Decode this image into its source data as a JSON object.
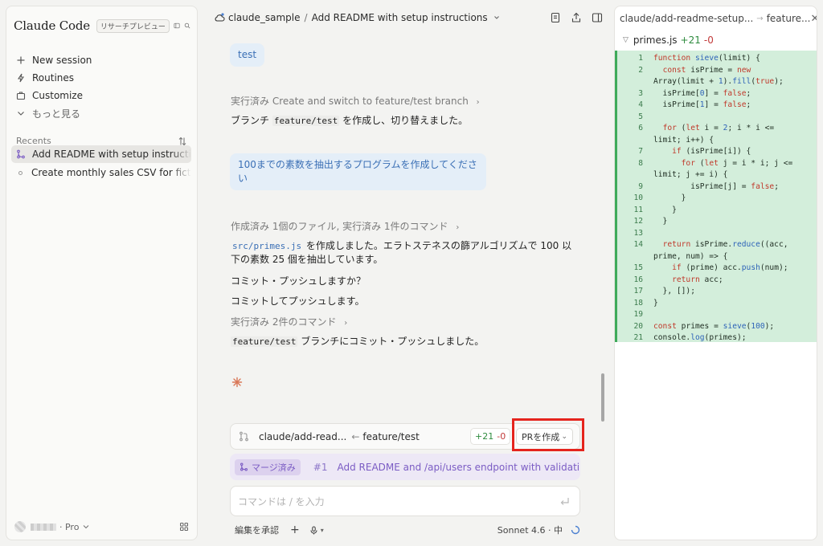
{
  "sidebar": {
    "brand": "Claude Code",
    "badge": "リサーチプレビュー",
    "nav": [
      {
        "label": "New session",
        "icon": "plus-icon"
      },
      {
        "label": "Routines",
        "icon": "routines-icon"
      },
      {
        "label": "Customize",
        "icon": "briefcase-icon"
      },
      {
        "label": "もっと見る",
        "icon": "chevron-down-icon"
      }
    ],
    "recents_label": "Recents",
    "recents": [
      {
        "label": "Add README with setup instructions",
        "active": true
      },
      {
        "label": "Create monthly sales CSV for fictional",
        "active": false
      }
    ],
    "plan": "· Pro"
  },
  "header": {
    "repo": "claude_sample",
    "separator": "/",
    "title": "Add README with setup instructions"
  },
  "chat": {
    "msg1": "test",
    "meta1": "実行済み Create and switch to feature/test branch",
    "reply1_pre": "ブランチ ",
    "reply1_code": "feature/test",
    "reply1_post": " を作成し、切り替えました。",
    "msg2": "100までの素数を抽出するプログラムを作成してください",
    "meta2": "作成済み 1個のファイル, 実行済み 1件のコマンド",
    "reply2_code": "src/primes.js",
    "reply2_text": " を作成しました。エラトステネスの篩アルゴリズムで 100 以下の素数 25 個を抽出しています。",
    "reply3": "コミット・プッシュしますか？",
    "reply4": "コミットしてプッシュします。",
    "meta3": "実行済み 2件のコマンド",
    "reply5_code": "feature/test",
    "reply5_text": " ブランチにコミット・プッシュしました。"
  },
  "branchbar": {
    "source": "claude/add-read...",
    "arrow": "←",
    "target": "feature/test",
    "additions": "+21",
    "deletions": "-0",
    "pr_button": "PRを作成"
  },
  "merged": {
    "badge": "マージ済み",
    "number": "#1",
    "title": "Add README and /api/users endpoint with validati..."
  },
  "input": {
    "placeholder": "コマンドは / を入力"
  },
  "footer": {
    "accept_edits": "編集を承認",
    "model": "Sonnet 4.6 · 中"
  },
  "panel": {
    "source_branch": "claude/add-readme-setup...",
    "target_branch": "feature...",
    "file": "primes.js",
    "additions": "+21",
    "deletions": "-0",
    "code": [
      {
        "n": "1",
        "t": "function sieve(limit) {"
      },
      {
        "n": "2",
        "t": "  const isPrime = new"
      },
      {
        "n": "",
        "t": "Array(limit + 1).fill(true);"
      },
      {
        "n": "3",
        "t": "  isPrime[0] = false;"
      },
      {
        "n": "4",
        "t": "  isPrime[1] = false;"
      },
      {
        "n": "5",
        "t": ""
      },
      {
        "n": "6",
        "t": "  for (let i = 2; i * i <="
      },
      {
        "n": "",
        "t": "limit; i++) {"
      },
      {
        "n": "7",
        "t": "    if (isPrime[i]) {"
      },
      {
        "n": "8",
        "t": "      for (let j = i * i; j <="
      },
      {
        "n": "",
        "t": "limit; j += i) {"
      },
      {
        "n": "9",
        "t": "        isPrime[j] = false;"
      },
      {
        "n": "10",
        "t": "      }"
      },
      {
        "n": "11",
        "t": "    }"
      },
      {
        "n": "12",
        "t": "  }"
      },
      {
        "n": "13",
        "t": ""
      },
      {
        "n": "14",
        "t": "  return isPrime.reduce((acc,"
      },
      {
        "n": "",
        "t": "prime, num) => {"
      },
      {
        "n": "15",
        "t": "    if (prime) acc.push(num);"
      },
      {
        "n": "16",
        "t": "    return acc;"
      },
      {
        "n": "17",
        "t": "  }, []);"
      },
      {
        "n": "18",
        "t": "}"
      },
      {
        "n": "19",
        "t": ""
      },
      {
        "n": "20",
        "t": "const primes = sieve(100);"
      },
      {
        "n": "21",
        "t": "console.log(primes);"
      }
    ]
  },
  "colors": {
    "accent_blue": "#3a6fb5",
    "merged_purple": "#7b5cc4",
    "add_green": "#2e8b3e",
    "del_red": "#c23a3a",
    "highlight_red": "#e5241d",
    "diff_bg": "#d3eedb"
  }
}
